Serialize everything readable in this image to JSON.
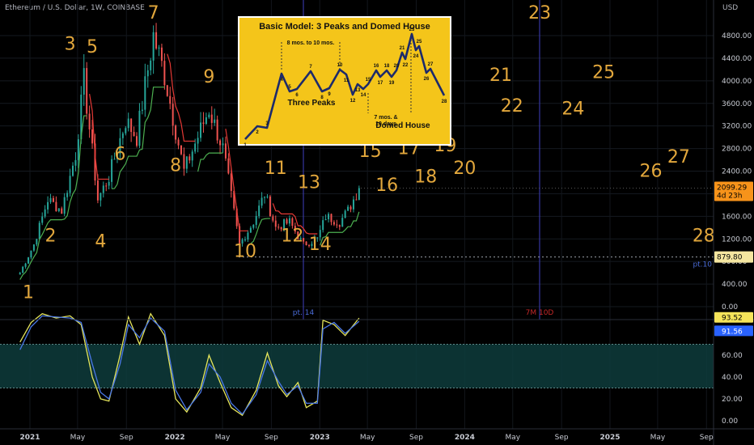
{
  "header": {
    "title": "Ethereum / U.S. Dollar, 1W, COINBASE",
    "currency": "USD"
  },
  "colors": {
    "wave": "#e2a73c",
    "up": "#26a69a",
    "down": "#ef5350",
    "line_green": "#4caf50",
    "line_red": "#e53935",
    "vline": "#3f3fbf",
    "k_line": "#e6e65c",
    "d_line": "#4a78e8",
    "band": "#0e3c3c",
    "price_tag": "#f7931a"
  },
  "chart_data": [
    {
      "type": "line",
      "title": "",
      "x_ticks": [
        "2021",
        "May",
        "Sep",
        "2022",
        "May",
        "Sep",
        "2023",
        "May",
        "Sep",
        "2024",
        "May",
        "Sep",
        "2025",
        "May",
        "Sep"
      ],
      "y_ticks": [
        "4800.00",
        "4400.00",
        "4000.00",
        "3600.00",
        "3200.00",
        "2800.00",
        "2400.00",
        "2000.00",
        "1600.00",
        "1200.00",
        "800.00",
        "400.00",
        "0.00"
      ],
      "ylim": [
        0,
        5000
      ],
      "current_price": "2099.29",
      "countdown": "4d 23h",
      "support_price": "879.80",
      "support_label": "pt.10",
      "vline_labels": [
        "pt. 14",
        "7M 10D"
      ],
      "price_path": {
        "dates": [
          "2020-12-07",
          "2021-01-11",
          "2021-02-15",
          "2021-03-22",
          "2021-04-26",
          "2021-05-17",
          "2021-06-21",
          "2021-07-19",
          "2021-08-30",
          "2021-09-27",
          "2021-11-08",
          "2021-12-06",
          "2022-01-24",
          "2022-03-28",
          "2022-05-02",
          "2022-06-13",
          "2022-07-18",
          "2022-08-15",
          "2022-09-12",
          "2022-10-17",
          "2022-11-07",
          "2022-11-21",
          "2022-12-26",
          "2023-01-16",
          "2023-02-20",
          "2023-03-13",
          "2023-04-10"
        ],
        "prices": [
          600,
          1100,
          1900,
          1700,
          2700,
          4000,
          1900,
          2300,
          3300,
          3000,
          4800,
          4100,
          2400,
          3500,
          2800,
          1100,
          1500,
          2000,
          1400,
          1500,
          1250,
          1100,
          1200,
          1600,
          1500,
          1700,
          2099
        ]
      },
      "wave_labels": [
        "1",
        "2",
        "3",
        "4",
        "5",
        "6",
        "7",
        "8",
        "9",
        "10",
        "11",
        "12",
        "13",
        "14",
        "15",
        "16",
        "17",
        "18",
        "19",
        "20",
        "21",
        "22",
        "23",
        "24",
        "25",
        "26",
        "27",
        "28"
      ],
      "wave_label_dates": [
        "2020-12-28",
        "2021-02-22",
        "2021-04-12",
        "2021-06-28",
        "2021-06-07",
        "2021-08-16",
        "2021-11-08",
        "2022-01-03",
        "2022-03-28",
        "2022-06-27",
        "2022-09-12",
        "2022-10-24",
        "2022-12-05",
        "2023-01-02",
        "2023-05-08",
        "2023-06-19",
        "2023-08-14",
        "2023-09-25",
        "2023-11-13",
        "2024-01-01",
        "2024-04-01",
        "2024-04-29",
        "2024-07-08",
        "2024-09-30",
        "2024-12-16",
        "2025-04-14",
        "2025-06-23",
        "2025-08-25"
      ],
      "wave_label_prices": [
        150,
        1150,
        4550,
        1050,
        4500,
        2600,
        5100,
        2400,
        3970,
        880,
        2350,
        1150,
        2100,
        1000,
        2650,
        2050,
        2700,
        2200,
        2750,
        2350,
        4000,
        3450,
        5100,
        3400,
        4050,
        2300,
        2550,
        1150
      ]
    },
    {
      "type": "line",
      "title": "",
      "y_ticks": [
        "80.00",
        "60.00",
        "40.00",
        "20.00",
        "0.00"
      ],
      "ylim": [
        0,
        100
      ],
      "band": [
        30,
        70
      ],
      "series": [
        {
          "name": "",
          "last": "93.52",
          "dates": [
            "2020-12-07",
            "2021-01-04",
            "2021-02-01",
            "2021-03-08",
            "2021-04-12",
            "2021-05-10",
            "2021-06-07",
            "2021-06-28",
            "2021-07-19",
            "2021-08-16",
            "2021-09-06",
            "2021-10-04",
            "2021-11-01",
            "2021-12-06",
            "2022-01-03",
            "2022-01-31",
            "2022-03-07",
            "2022-03-28",
            "2022-04-25",
            "2022-05-23",
            "2022-06-20",
            "2022-07-25",
            "2022-08-22",
            "2022-09-19",
            "2022-10-10",
            "2022-11-07",
            "2022-11-28",
            "2022-12-26",
            "2023-01-09",
            "2023-02-06",
            "2023-03-06",
            "2023-04-10"
          ],
          "values": [
            72,
            90,
            98,
            94,
            96,
            88,
            40,
            20,
            18,
            60,
            95,
            70,
            98,
            78,
            20,
            8,
            30,
            60,
            35,
            12,
            5,
            28,
            62,
            32,
            22,
            35,
            12,
            18,
            92,
            88,
            78,
            94
          ]
        },
        {
          "name": "",
          "last": "91.56",
          "dates": [
            "2020-12-07",
            "2021-01-04",
            "2021-02-01",
            "2021-03-08",
            "2021-04-12",
            "2021-05-10",
            "2021-06-07",
            "2021-06-28",
            "2021-07-19",
            "2021-08-16",
            "2021-09-06",
            "2021-10-04",
            "2021-11-01",
            "2021-12-06",
            "2022-01-03",
            "2022-01-31",
            "2022-03-07",
            "2022-03-28",
            "2022-04-25",
            "2022-05-23",
            "2022-06-20",
            "2022-07-25",
            "2022-08-22",
            "2022-09-19",
            "2022-10-10",
            "2022-11-07",
            "2022-11-28",
            "2022-12-26",
            "2023-01-09",
            "2023-02-06",
            "2023-03-06",
            "2023-04-10"
          ],
          "values": [
            65,
            86,
            96,
            95,
            94,
            90,
            52,
            26,
            20,
            52,
            88,
            76,
            94,
            82,
            28,
            10,
            26,
            52,
            40,
            16,
            6,
            24,
            55,
            36,
            24,
            32,
            16,
            16,
            84,
            90,
            80,
            91
          ]
        }
      ]
    }
  ],
  "inset": {
    "title": "Basic Model: 3 Peaks and Domed House",
    "span1": "8 mos. to 10 mos.",
    "three_peaks": "Three Peaks",
    "span2_a": "7 mos. &",
    "span2_b": "10 days",
    "domed_house": "Domed House",
    "points": [
      "1",
      "2",
      "3",
      "4",
      "5",
      "6",
      "7",
      "8",
      "9",
      "10",
      "11",
      "12",
      "13",
      "14",
      "15",
      "16",
      "17",
      "18",
      "19",
      "20",
      "21",
      "22",
      "23",
      "24",
      "25",
      "26",
      "27",
      "28"
    ]
  }
}
